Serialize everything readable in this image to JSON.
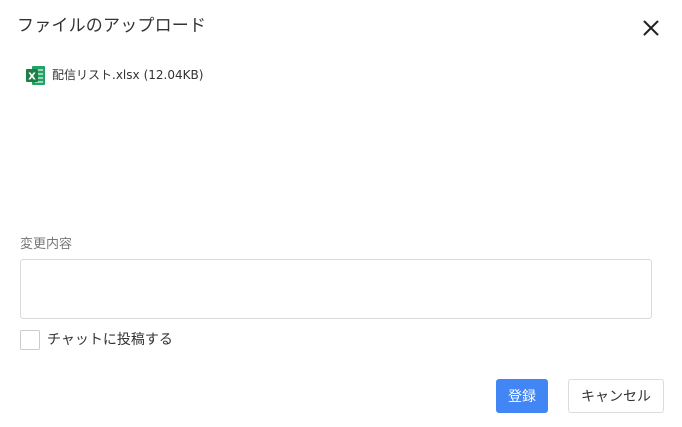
{
  "dialog": {
    "title": "ファイルのアップロード",
    "close_icon": "close-icon"
  },
  "file": {
    "icon": "excel-file-icon",
    "icon_letter": "X",
    "icon_color": "#1e7e45",
    "name": "配信リスト.xlsx",
    "size": "(12.04KB)"
  },
  "changes": {
    "label": "変更内容",
    "value": "",
    "placeholder": ""
  },
  "chat_post": {
    "label": "チャットに投稿する",
    "checked": false
  },
  "buttons": {
    "register_label": "登録",
    "cancel_label": "キャンセル"
  },
  "colors": {
    "primary": "#4285f4",
    "excel_green": "#1e7e45"
  }
}
